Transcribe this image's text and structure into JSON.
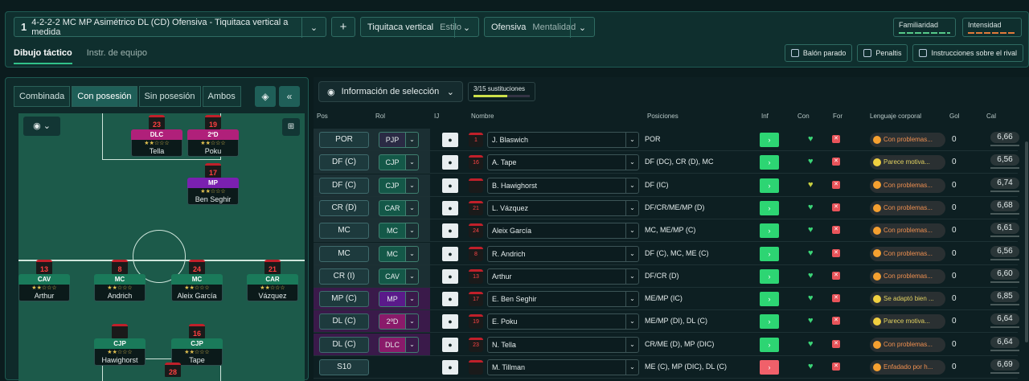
{
  "header": {
    "formation_num": "1",
    "formation": "4-2-2-2 MC MP Asimétrico DL (CD) Ofensiva - Tiquitaca vertical a medida",
    "style_value": "Tiquitaca vertical",
    "style_label": "Estilo",
    "mentality_value": "Ofensiva",
    "mentality_label": "Mentalidad",
    "familiarity": "Familiaridad",
    "intensity": "Intensidad"
  },
  "subtabs": [
    "Dibujo táctico",
    "Instr. de equipo"
  ],
  "actions": [
    "Balón parado",
    "Penaltis",
    "Instrucciones sobre el rival"
  ],
  "left": {
    "tabs": [
      "Combinada",
      "Con posesión",
      "Sin posesión",
      "Ambos"
    ]
  },
  "pitch_players": [
    {
      "num": "23",
      "role": "DLC",
      "name": "Tella",
      "color": "#b0207a"
    },
    {
      "num": "19",
      "role": "2ºD",
      "name": "Poku",
      "color": "#b0207a"
    },
    {
      "num": "17",
      "role": "MP",
      "name": "Ben Seghir",
      "color": "#7a20b0"
    },
    {
      "num": "13",
      "role": "CAV",
      "name": "Arthur",
      "color": "#1a7a5a"
    },
    {
      "num": "8",
      "role": "MC",
      "name": "Andrich",
      "color": "#1a7a5a"
    },
    {
      "num": "24",
      "role": "MC",
      "name": "Aleix García",
      "color": "#1a7a5a"
    },
    {
      "num": "21",
      "role": "CAR",
      "name": "Vázquez",
      "color": "#1a7a5a"
    },
    {
      "num": "",
      "role": "CJP",
      "name": "Hawighorst",
      "color": "#1a7a5a"
    },
    {
      "num": "16",
      "role": "CJP",
      "name": "Tape",
      "color": "#1a7a5a"
    },
    {
      "num": "28",
      "role": "",
      "name": "",
      "color": "#1a7a5a"
    }
  ],
  "panel": {
    "info_label": "Información de selección",
    "subs": "3/15 sustituciones"
  },
  "columns": [
    "Pos",
    "Rol",
    "IJ",
    "Nombre",
    "Posiciones",
    "Inf",
    "Con",
    "For",
    "Lenguaje corporal",
    "Gol",
    "Cal"
  ],
  "rows": [
    {
      "pos": "POR",
      "rol": "PJP",
      "num": "1",
      "name": "J. Blaswich",
      "positions": "POR",
      "body": "Con problemas...",
      "gol": "0",
      "cal": "6,66"
    },
    {
      "pos": "DF (C)",
      "rol": "CJP",
      "num": "16",
      "name": "A. Tape",
      "positions": "DF (DC), CR (D), MC",
      "body": "Parece motiva...",
      "gol": "0",
      "cal": "6,56"
    },
    {
      "pos": "DF (C)",
      "rol": "CJP",
      "num": "",
      "name": "B. Hawighorst",
      "positions": "DF (IC)",
      "body": "Con problemas...",
      "gol": "0",
      "cal": "6,74"
    },
    {
      "pos": "CR (D)",
      "rol": "CAR",
      "num": "21",
      "name": "L. Vázquez",
      "positions": "DF/CR/ME/MP (D)",
      "body": "Con problemas...",
      "gol": "0",
      "cal": "6,68"
    },
    {
      "pos": "MC",
      "rol": "MC",
      "num": "24",
      "name": "Aleix García",
      "positions": "MC, ME/MP (C)",
      "body": "Con problemas...",
      "gol": "0",
      "cal": "6,61"
    },
    {
      "pos": "MC",
      "rol": "MC",
      "num": "8",
      "name": "R. Andrich",
      "positions": "DF (C), MC, ME (C)",
      "body": "Con problemas...",
      "gol": "0",
      "cal": "6,56"
    },
    {
      "pos": "CR (I)",
      "rol": "CAV",
      "num": "13",
      "name": "Arthur",
      "positions": "DF/CR (D)",
      "body": "Con problemas...",
      "gol": "0",
      "cal": "6,60"
    },
    {
      "pos": "MP (C)",
      "rol": "MP",
      "num": "17",
      "name": "E. Ben Seghir",
      "positions": "ME/MP (IC)",
      "body": "Se adaptó bien ...",
      "gol": "0",
      "cal": "6,85"
    },
    {
      "pos": "DL (C)",
      "rol": "2ºD",
      "num": "19",
      "name": "E. Poku",
      "positions": "ME/MP (DI), DL (C)",
      "body": "Parece motiva...",
      "gol": "0",
      "cal": "6,64"
    },
    {
      "pos": "DL (C)",
      "rol": "DLC",
      "num": "23",
      "name": "N. Tella",
      "positions": "CR/ME (D), MP (DIC)",
      "body": "Con problemas...",
      "gol": "0",
      "cal": "6,64"
    },
    {
      "pos": "S10",
      "rol": "",
      "num": "",
      "name": "M. Tillman",
      "positions": "ME (C), MP (DIC), DL (C)",
      "body": "Enfadado por h...",
      "gol": "0",
      "cal": "6,69"
    }
  ]
}
